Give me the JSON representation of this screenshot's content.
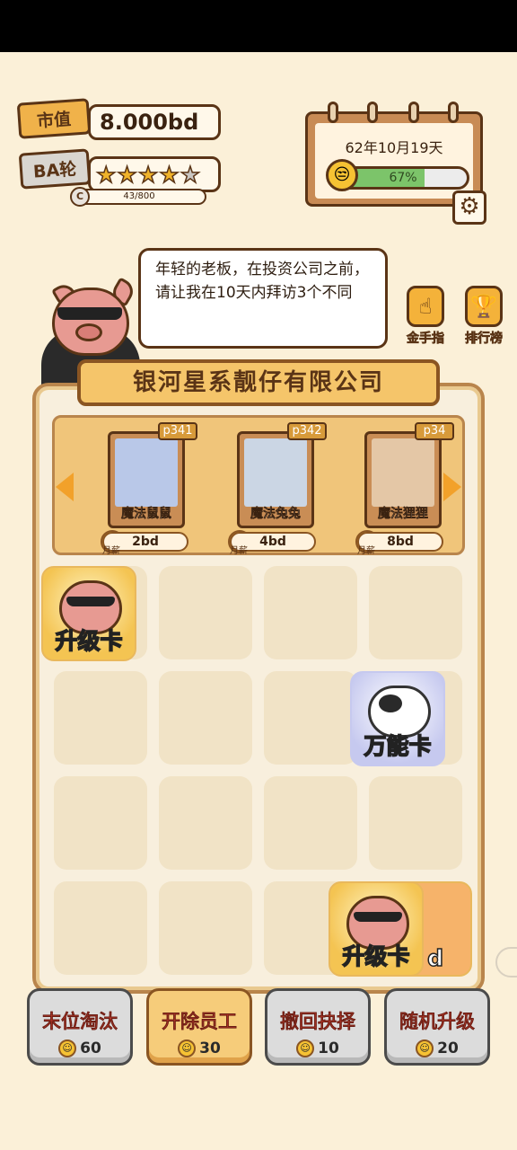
{
  "stats": {
    "market_value_label": "市值",
    "market_value": "8.000bd",
    "round_label": "BA轮",
    "stars_total": 5,
    "stars_filled": 4,
    "rank_badge": "C",
    "xp_text": "43/800"
  },
  "calendar": {
    "date": "62年10月19天",
    "mood_percent": 67,
    "mood_text": "67%"
  },
  "speech": {
    "text": "年轻的老板，在投资公司之前，请让我在10天内拜访3个不同"
  },
  "side": {
    "golden_finger": "金手指",
    "leaderboard": "排行榜"
  },
  "company": {
    "name": "银河星系靓仔有限公司"
  },
  "shop": {
    "cards": [
      {
        "code": "p341",
        "name": "魔法鼠鼠",
        "price": "2bd",
        "coin_label": "月薪"
      },
      {
        "code": "p342",
        "name": "魔法兔兔",
        "price": "4bd",
        "coin_label": "月薪"
      },
      {
        "code": "p34",
        "name": "魔法狸狸",
        "price": "8bd",
        "coin_label": "月薪"
      }
    ]
  },
  "grid": {
    "upgrade_card_label": "升级卡",
    "wild_card_label": "万能卡",
    "peek_label": "d"
  },
  "actions": [
    {
      "label": "末位淘汰",
      "cost": "60"
    },
    {
      "label": "开除员工",
      "cost": "30"
    },
    {
      "label": "撤回抉择",
      "cost": "10"
    },
    {
      "label": "随机升级",
      "cost": "20"
    }
  ],
  "colors": {
    "background": "#fbf0d8",
    "outline": "#5a3416",
    "action_text": "#c23a2a",
    "mood_fill": "#7cc46a"
  }
}
